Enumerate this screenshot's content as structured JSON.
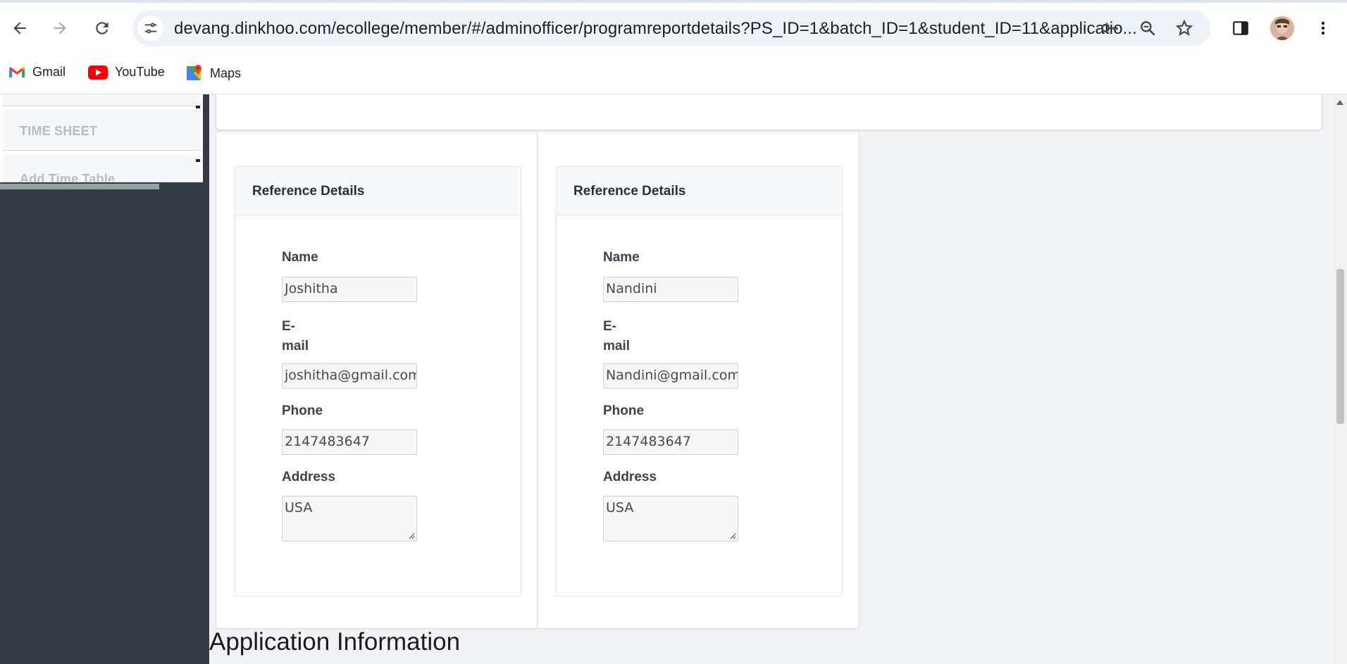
{
  "browser": {
    "url": "devang.dinkhoo.com/ecollege/member/#/adminofficer/programreportdetails?PS_ID=1&batch_ID=1&student_ID=11&applicatio...",
    "bookmarks": [
      {
        "label": "Gmail",
        "icon": "gmail-icon"
      },
      {
        "label": "YouTube",
        "icon": "youtube-icon"
      },
      {
        "label": "Maps",
        "icon": "maps-icon"
      }
    ]
  },
  "sidebar": {
    "items": [
      {
        "label": ""
      },
      {
        "label": "TIME SHEET"
      },
      {
        "label": "Add Time Table"
      }
    ]
  },
  "references": [
    {
      "title": "Reference Details",
      "name_label": "Name",
      "name_value": "Joshitha",
      "email_label_line1": "E-",
      "email_label_line2": "mail",
      "email_value": "joshitha@gmail.com",
      "phone_label": "Phone",
      "phone_value": "2147483647",
      "address_label": "Address",
      "address_value": "USA"
    },
    {
      "title": "Reference Details",
      "name_label": "Name",
      "name_value": "Nandini",
      "email_label_line1": "E-",
      "email_label_line2": "mail",
      "email_value": "Nandini@gmail.com",
      "phone_label": "Phone",
      "phone_value": "2147483647",
      "address_label": "Address",
      "address_value": "USA"
    }
  ],
  "section": {
    "heading": "Application Information"
  },
  "colors": {
    "sidebar_bg": "#353a43",
    "page_bg": "#f2f3f7",
    "omnibox_bg": "#edf1f8"
  }
}
